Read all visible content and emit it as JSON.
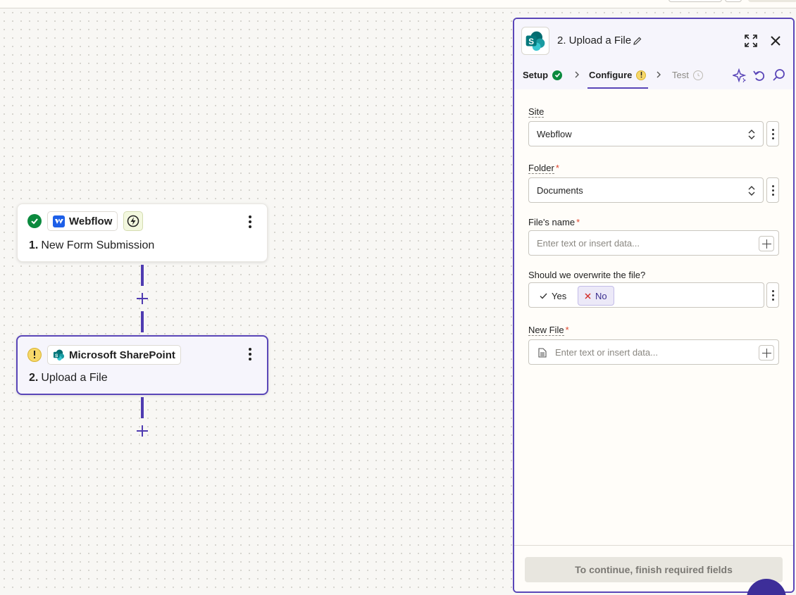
{
  "canvas": {
    "nodes": [
      {
        "step": "1.",
        "title": "New Form Submission",
        "app": "Webflow",
        "status": "complete"
      },
      {
        "step": "2.",
        "title": "Upload a File",
        "app": "Microsoft SharePoint",
        "status": "warning"
      }
    ]
  },
  "panel": {
    "title": "2. Upload a File",
    "tabs": {
      "setup": "Setup",
      "configure": "Configure",
      "test": "Test"
    },
    "fields": {
      "site": {
        "label": "Site",
        "value": "Webflow"
      },
      "folder": {
        "label": "Folder",
        "required": "*",
        "value": "Documents"
      },
      "file_name": {
        "label": "File's name",
        "required": "*",
        "placeholder": "Enter text or insert data..."
      },
      "overwrite": {
        "label": "Should we overwrite the file?",
        "yes": "Yes",
        "no": "No",
        "selected": "No"
      },
      "new_file": {
        "label": "New File",
        "required": "*",
        "placeholder": "Enter text or insert data..."
      }
    },
    "footer": {
      "continue_label": "To continue, finish required fields"
    }
  },
  "colors": {
    "accent": "#5a46b8",
    "success": "#0b8a3e",
    "warning": "#f7d86a",
    "required": "#e0452c"
  },
  "icons": [
    "check-icon",
    "webflow-logo-icon",
    "bolt-icon",
    "warning-icon",
    "sharepoint-logo-icon",
    "pencil-icon",
    "expand-icon",
    "close-icon",
    "chevron-right-icon",
    "sparkle-icon",
    "undo-icon",
    "search-icon",
    "updown-icon",
    "plus-icon",
    "file-icon"
  ]
}
